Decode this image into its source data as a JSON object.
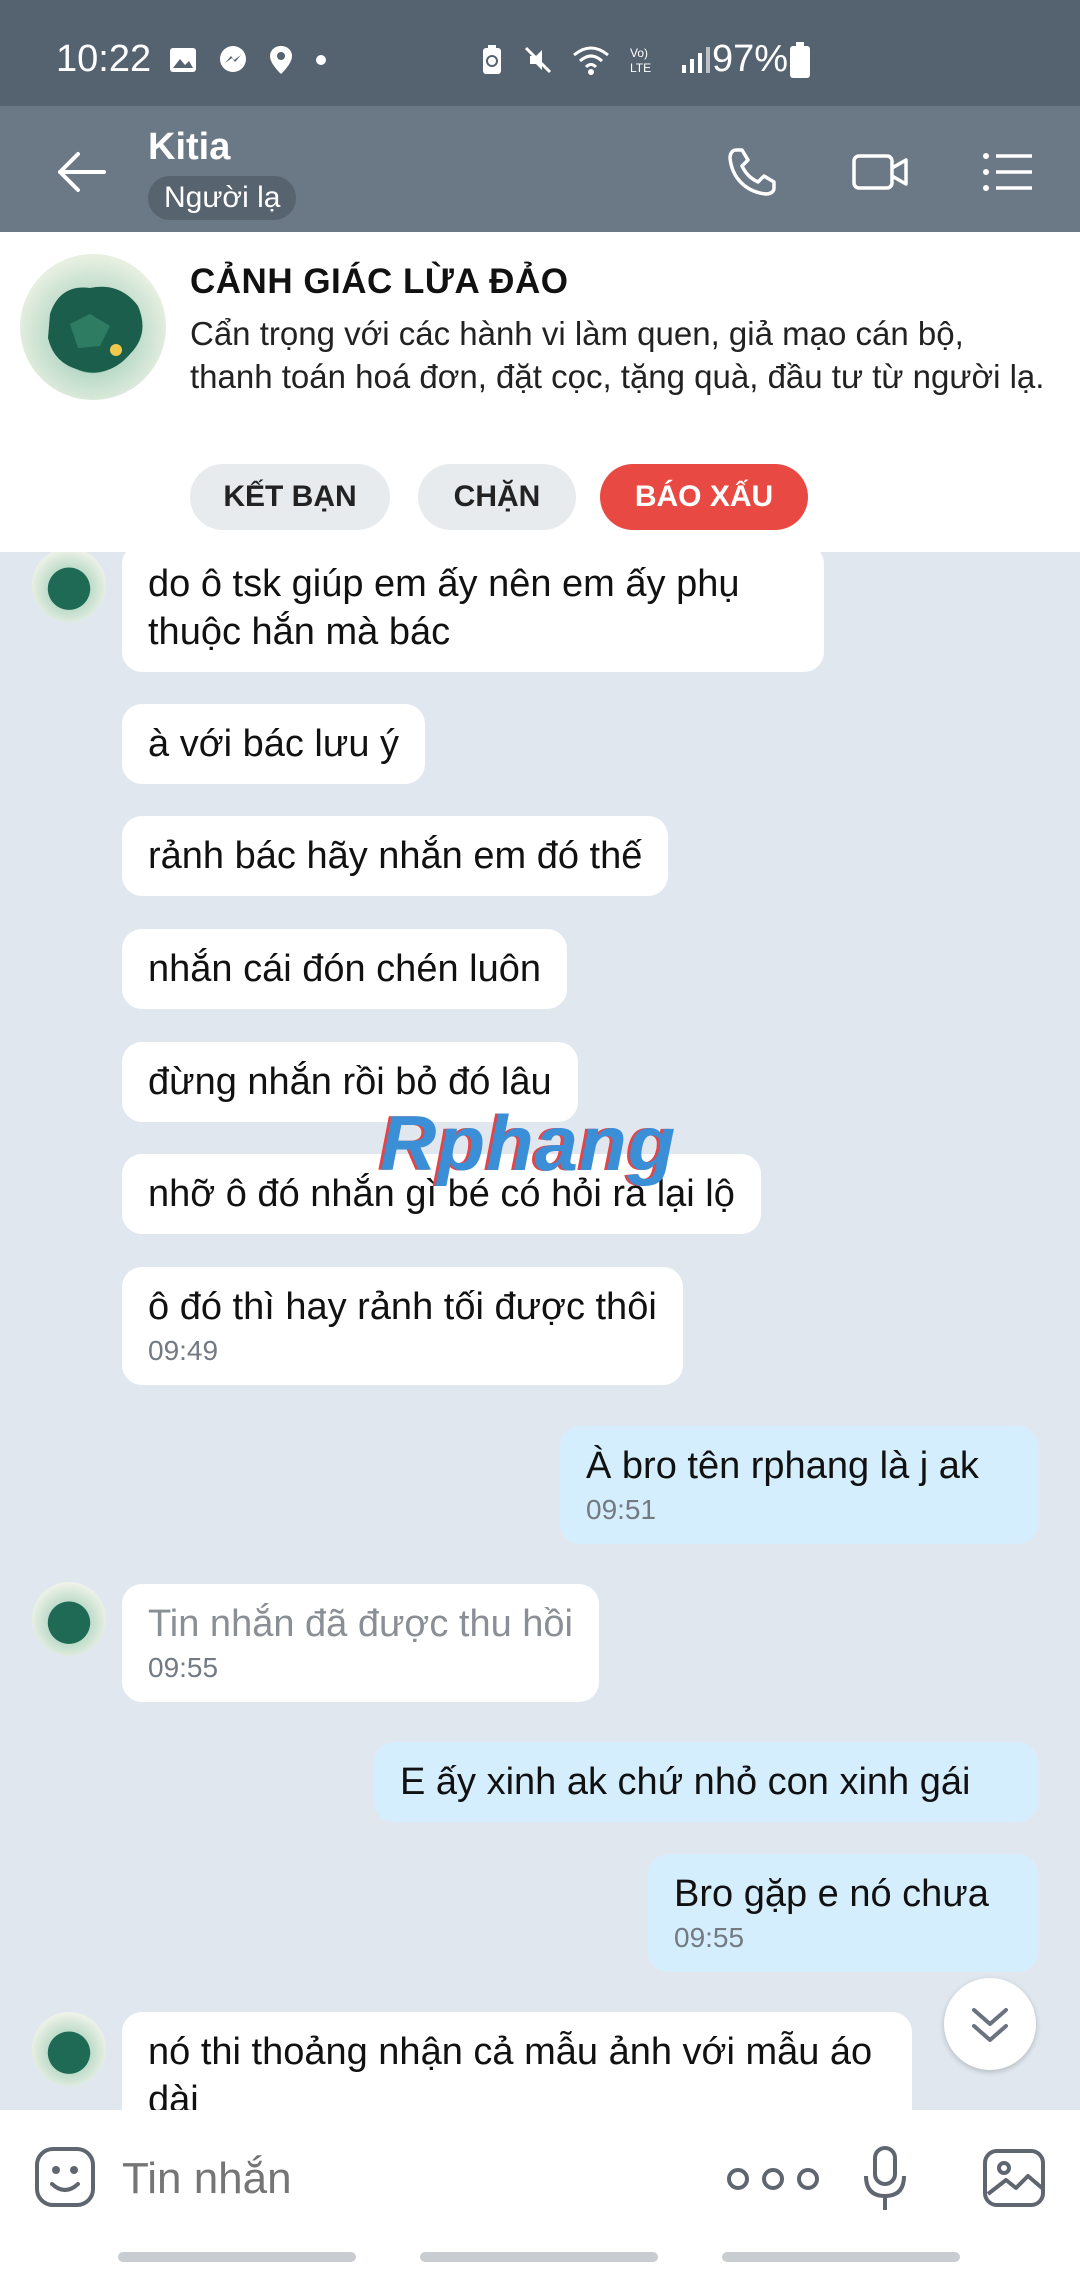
{
  "status_bar": {
    "time": "10:22",
    "battery": "97%",
    "left_icons": [
      "gallery-icon",
      "messenger-icon",
      "location-icon",
      "dot-icon"
    ],
    "right_icons": [
      "battery-saver-icon",
      "mute-icon",
      "wifi-icon",
      "volte-icon",
      "signal-icon"
    ]
  },
  "header": {
    "title": "Kitia",
    "badge": "Người lạ"
  },
  "warning": {
    "title": "CẢNH GIÁC LỪA ĐẢO",
    "text": "Cẩn trọng với các hành vi làm quen, giả mạo cán bộ, thanh toán hoá đơn, đặt cọc, tặng quà, đầu tư từ người lạ.",
    "buttons": {
      "add_friend": "KẾT BẠN",
      "block": "CHẶN",
      "report": "BÁO XẤU"
    }
  },
  "messages": [
    {
      "from": "them",
      "text": "do ô tsk giúp em ấy nên em ấy phụ thuộc hắn mà bác",
      "time": ""
    },
    {
      "from": "them",
      "text": "à với bác lưu ý",
      "time": ""
    },
    {
      "from": "them",
      "text": "rảnh bác hãy nhắn em đó thế",
      "time": ""
    },
    {
      "from": "them",
      "text": "nhắn cái đón chén luôn",
      "time": ""
    },
    {
      "from": "them",
      "text": "đừng nhắn rồi bỏ đó lâu",
      "time": ""
    },
    {
      "from": "them",
      "text": "nhỡ ô đó nhắn gì bé có hỏi ra lại lộ",
      "time": ""
    },
    {
      "from": "them",
      "text": "ô đó thì hay rảnh tối được thôi",
      "time": "09:49"
    },
    {
      "from": "me",
      "text": "À bro tên rphang là j ak",
      "time": "09:51"
    },
    {
      "from": "them",
      "text": "Tin nhắn đã được thu hồi",
      "time": "09:55",
      "recalled": true
    },
    {
      "from": "me",
      "text": "E ấy xinh ak chứ nhỏ con xinh gái",
      "time": ""
    },
    {
      "from": "me",
      "text": "Bro gặp e nó chưa",
      "time": "09:55"
    },
    {
      "from": "them",
      "text": "nó thi thoảng nhận cả mẫu ảnh với mẫu áo dài",
      "time": ""
    }
  ],
  "watermark": "Rphang",
  "input": {
    "placeholder": "Tin nhắn"
  },
  "colors": {
    "status_bar": "#556270",
    "header": "#6b7886",
    "chat_bg": "#e1e7ef",
    "my_bubble": "#d5eefd",
    "report_button": "#e84a43"
  }
}
